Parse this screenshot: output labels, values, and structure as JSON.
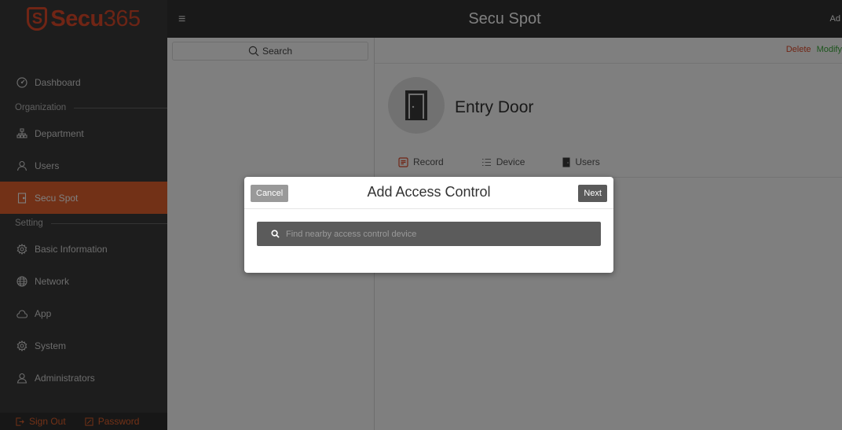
{
  "brand": {
    "badge": "S",
    "name": "Secu",
    "number": "365"
  },
  "header": {
    "title": "Secu Spot",
    "user_partial": "Ad"
  },
  "sidebar": {
    "items": [
      {
        "label": "Dashboard",
        "icon": "dashboard-icon"
      },
      {
        "section": "Organization"
      },
      {
        "label": "Department",
        "icon": "department-icon"
      },
      {
        "label": "Users",
        "icon": "user-icon"
      },
      {
        "label": "Secu Spot",
        "icon": "door-icon",
        "active": true
      },
      {
        "section": "Setting"
      },
      {
        "label": "Basic Information",
        "icon": "gear-icon"
      },
      {
        "label": "Network",
        "icon": "globe-icon"
      },
      {
        "label": "App",
        "icon": "cloud-icon"
      },
      {
        "label": "System",
        "icon": "gear-icon"
      },
      {
        "label": "Administrators",
        "icon": "admin-icon"
      }
    ],
    "footer": {
      "sign_out": "Sign Out",
      "password": "Password"
    }
  },
  "list": {
    "search_label": "Search"
  },
  "detail": {
    "delete_label": "Delete",
    "modify_label": "Modify",
    "door_name": "Entry Door",
    "tabs": [
      "Record",
      "Device",
      "Users"
    ]
  },
  "dialog": {
    "title": "Add Access Control",
    "cancel_label": "Cancel",
    "next_label": "Next",
    "search_placeholder": "Find nearby access control device"
  },
  "colors": {
    "accent": "#e5622e",
    "sidebar_bg": "#3a3a3a",
    "header_bg": "#333333",
    "delete": "#e04a2a",
    "modify": "#3aaa3a"
  }
}
